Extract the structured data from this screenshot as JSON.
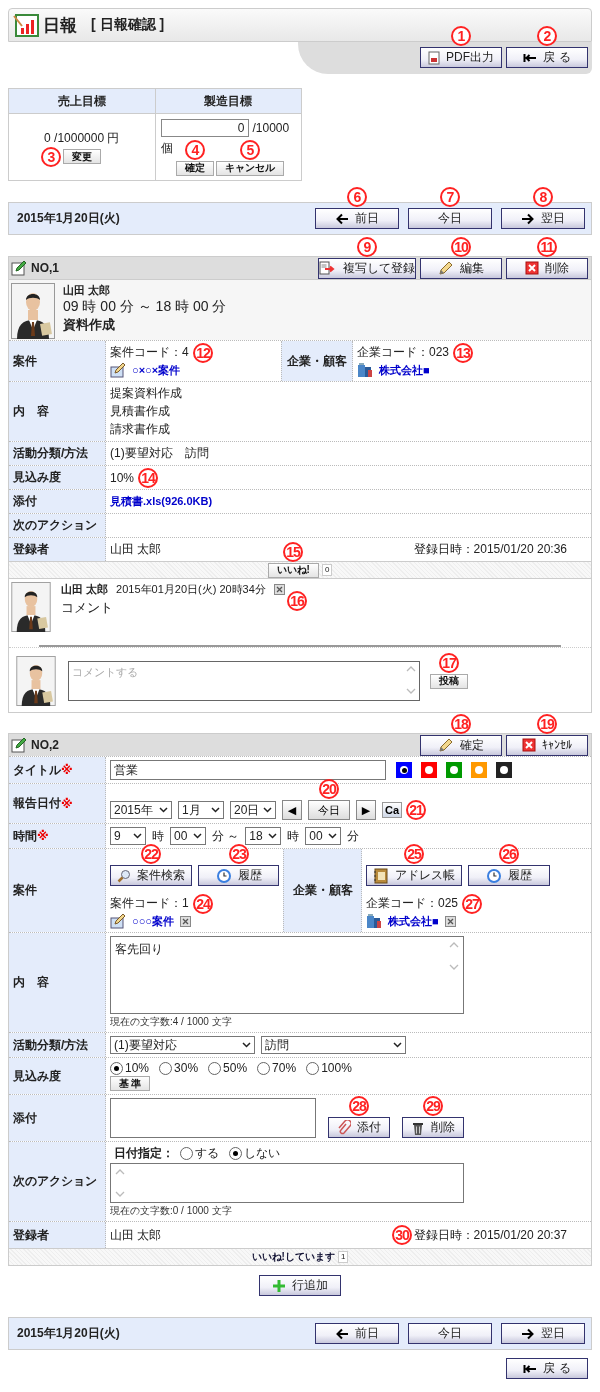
{
  "header": {
    "title": "日報",
    "subtitle": "[ 日報確認 ]",
    "buttons": [
      {
        "kind": "pdf",
        "label": "PDF出力"
      },
      {
        "kind": "back",
        "label": "戻 る"
      }
    ]
  },
  "goals": {
    "columns": [
      "売上目標",
      "製造目標"
    ],
    "sales": {
      "value": "0 /1000000 円",
      "button": "変更"
    },
    "production": {
      "value": "0",
      "max": "/10000",
      "unit": "個",
      "buttons": [
        "確定",
        "キャンセル"
      ]
    }
  },
  "date_bar_top": {
    "date": "2015年1月20日(火)",
    "buttons": [
      {
        "kind": "prev",
        "label": "前日"
      },
      {
        "kind": "today",
        "label": "今日"
      },
      {
        "kind": "next",
        "label": "翌日"
      }
    ]
  },
  "report_1": {
    "number": "NO,1",
    "buttons": [
      {
        "kind": "copy",
        "label": "複写して登録"
      },
      {
        "kind": "edit",
        "label": "編集"
      },
      {
        "kind": "delete",
        "label": "削除"
      }
    ],
    "author": "山田 太郎",
    "time": "09 時 00 分 ～ 18 時 00 分",
    "title": "資料作成",
    "project": {
      "label": "案件",
      "code": "案件コード：4",
      "name": "○×○×案件"
    },
    "client": {
      "label": "企業・顧客",
      "code": "企業コード：023",
      "name": "株式会社■"
    },
    "rows": [
      {
        "label": "内　容",
        "lines": [
          "提案資料作成",
          "見積書作成",
          "請求書作成"
        ]
      },
      {
        "label": "活動分類/方法",
        "lines": [
          "(1)要望対応　訪問"
        ]
      },
      {
        "label": "見込み度",
        "lines": [
          "10%"
        ]
      },
      {
        "label": "添付",
        "link": "見積書.xls(926.0KB)"
      },
      {
        "label": "次のアクション"
      }
    ],
    "registrant": {
      "label": "登録者",
      "name": "山田 太郎",
      "registered": "登録日時：2015/01/20 20:36"
    },
    "like": {
      "button": "いいね!",
      "count": "0"
    },
    "comments": [
      {
        "author": "山田 太郎",
        "date": "2015年01月20日(火) 20時34分",
        "text": "コメント"
      }
    ],
    "comment_box": {
      "placeholder": "コメントする",
      "button": "投稿"
    }
  },
  "report_2": {
    "number": "NO,2",
    "buttons": [
      {
        "kind": "edit",
        "label": "確定"
      },
      {
        "kind": "delete",
        "label": "ｷｬﾝｾﾙ"
      }
    ],
    "title_row": {
      "label": "タイトル",
      "required": "※",
      "value": "営業",
      "colors": [
        {
          "color": "#0000ff",
          "selected": true
        },
        {
          "color": "#ff0000",
          "selected": false
        },
        {
          "color": "#009900",
          "selected": false
        },
        {
          "color": "#ff9900",
          "selected": false
        },
        {
          "color": "#222222",
          "selected": false
        }
      ]
    },
    "date_row": {
      "label": "報告日付",
      "required": "※",
      "year": "2015年",
      "month": "1月",
      "day": "20日",
      "prev": "◀",
      "today": "今日",
      "next": "▶",
      "calendar": "Ca"
    },
    "time_row": {
      "label": "時間",
      "required": "※",
      "parts": [
        {
          "kind": "select",
          "value": "9"
        },
        {
          "kind": "text",
          "value": "時"
        },
        {
          "kind": "select",
          "value": "00"
        },
        {
          "kind": "text",
          "value": "分 ～"
        },
        {
          "kind": "select",
          "value": "18"
        },
        {
          "kind": "text",
          "value": "時"
        },
        {
          "kind": "select",
          "value": "00"
        },
        {
          "kind": "text",
          "value": "分"
        }
      ]
    },
    "project": {
      "label": "案件",
      "buttons": [
        {
          "kind": "search",
          "label": "案件検索"
        },
        {
          "kind": "history",
          "label": "履歴"
        }
      ],
      "code": "案件コード：1",
      "name": "○○○案件"
    },
    "client": {
      "label": "企業・顧客",
      "buttons": [
        {
          "kind": "address",
          "label": "アドレス帳"
        },
        {
          "kind": "history",
          "label": "履歴"
        }
      ],
      "code": "企業コード：025",
      "name": "株式会社■"
    },
    "content": {
      "label": "内　容",
      "value": "客先回り",
      "counter": "現在の文字数:4 / 1000 文字"
    },
    "activity": {
      "label": "活動分類/方法",
      "category": "(1)要望対応",
      "method": "訪問"
    },
    "probability": {
      "label": "見込み度",
      "options": [
        {
          "label": "10%",
          "selected": true
        },
        {
          "label": "30%",
          "selected": false
        },
        {
          "label": "50%",
          "selected": false
        },
        {
          "label": "70%",
          "selected": false
        },
        {
          "label": "100%",
          "selected": false
        }
      ],
      "button": "基 準"
    },
    "attachment": {
      "label": "添付",
      "buttons": [
        {
          "kind": "attach",
          "label": "添付"
        },
        {
          "kind": "trash",
          "label": "削除"
        }
      ]
    },
    "next_action": {
      "label": "次のアクション",
      "date_label": "日付指定：",
      "options": [
        {
          "label": "する",
          "selected": false
        },
        {
          "label": "しない",
          "selected": true
        }
      ],
      "counter": "現在の文字数:0 / 1000 文字"
    },
    "registrant": {
      "label": "登録者",
      "name": "山田 太郎",
      "registered": "登録日時：2015/01/20 20:37"
    },
    "like": {
      "label": "いいね!しています",
      "count": "1"
    }
  },
  "add_row": {
    "kind": "add",
    "label": "行追加"
  },
  "date_bar_bottom": {
    "date": "2015年1月20日(火)",
    "buttons": [
      {
        "kind": "prev",
        "label": "前日"
      },
      {
        "kind": "today",
        "label": "今日"
      },
      {
        "kind": "next",
        "label": "翌日"
      }
    ]
  },
  "back_button": {
    "kind": "back",
    "label": "戻 る"
  },
  "callouts": [
    "1",
    "2",
    "3",
    "4",
    "5",
    "6",
    "7",
    "8",
    "9",
    "10",
    "11",
    "12",
    "13",
    "14",
    "15",
    "16",
    "17",
    "18",
    "19",
    "20",
    "21",
    "22",
    "23",
    "24",
    "25",
    "26",
    "27",
    "28",
    "29",
    "30"
  ]
}
